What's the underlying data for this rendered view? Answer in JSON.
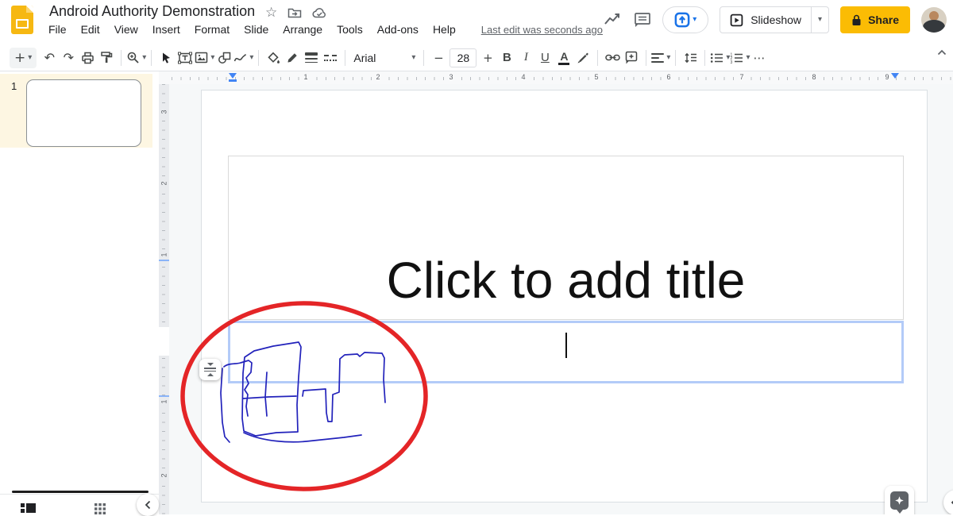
{
  "header": {
    "doc_title": "Android Authority Demonstration",
    "menus": [
      "File",
      "Edit",
      "View",
      "Insert",
      "Format",
      "Slide",
      "Arrange",
      "Tools",
      "Add-ons",
      "Help"
    ],
    "last_edit_status": "Last edit was seconds ago",
    "slideshow_button": "Slideshow",
    "share_button": "Share"
  },
  "toolbar": {
    "font_family_value": "Arial",
    "font_size_value": "28"
  },
  "icons": {
    "caret_down": "▾",
    "undo": "↶",
    "redo": "↷",
    "plus": "+",
    "minus": "−",
    "more_h": "⋯",
    "star": "☆",
    "bold": "B",
    "italic": "I",
    "underline": "U",
    "text_color": "A"
  },
  "rulers": {
    "horizontal_numbers": [
      "1",
      "2",
      "3",
      "4",
      "5",
      "6",
      "7",
      "8",
      "9"
    ],
    "vertical_labels": [
      "3",
      "2",
      "1",
      "1",
      "2"
    ]
  },
  "filmstrip": {
    "slide_number": "1"
  },
  "canvas": {
    "title_placeholder": "Click to add title"
  },
  "colors": {
    "accent_blue": "#1a73e8",
    "share_yellow": "#fbbc04",
    "annotation_red": "#e42527",
    "scribble_blue": "#2222bb",
    "selection_border": "#b3cbf8"
  }
}
